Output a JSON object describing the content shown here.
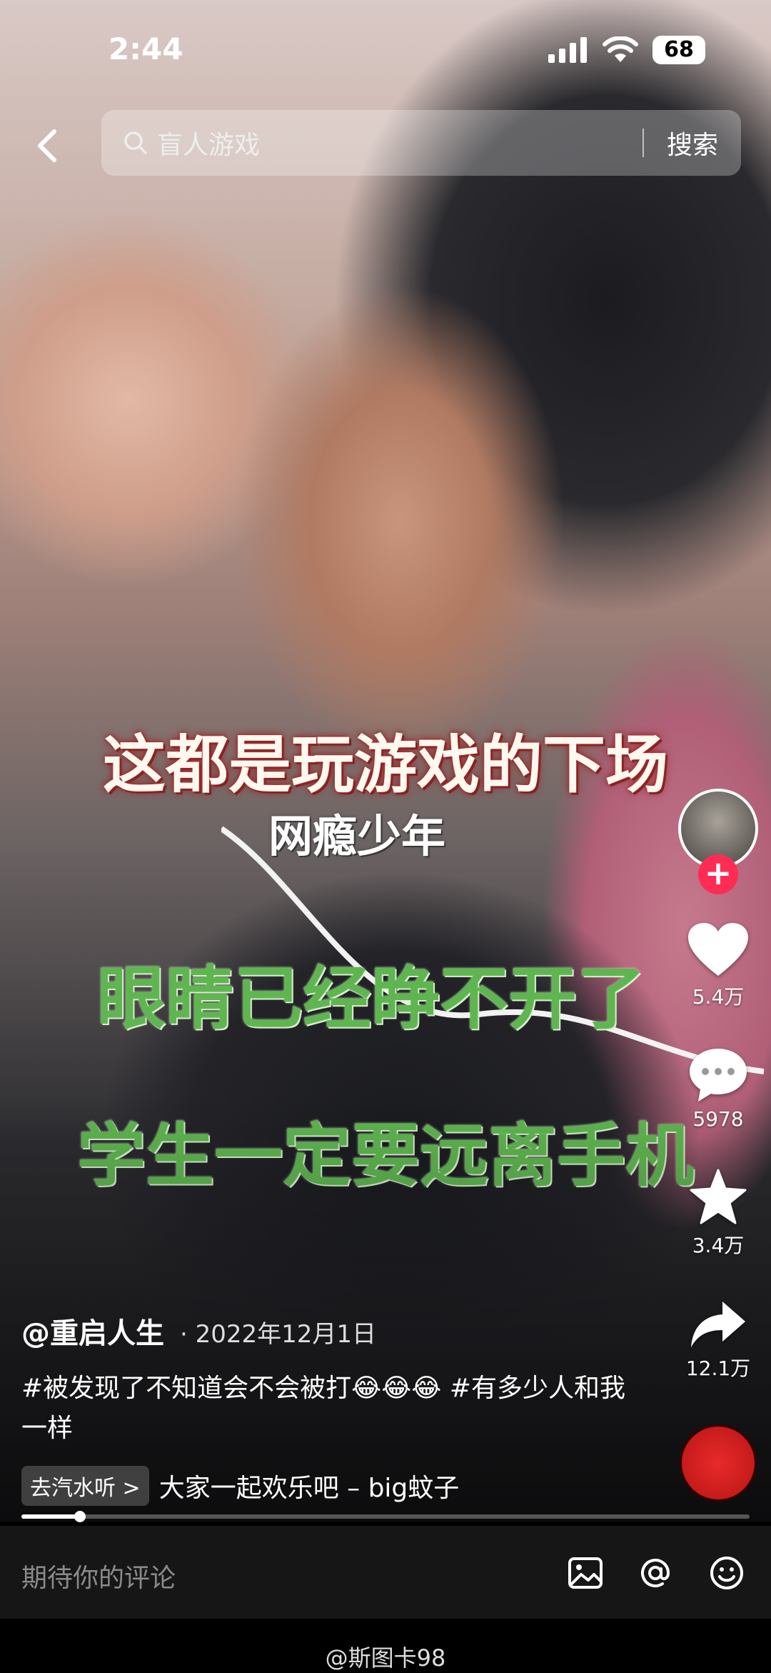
{
  "status": {
    "time": "2:44",
    "battery": "68"
  },
  "search": {
    "query": "盲人游戏",
    "button_label": "搜索"
  },
  "video_captions": {
    "line1": "这都是玩游戏的下场",
    "line2": "网瘾少年",
    "line3": "眼睛已经睁不开了",
    "line4": "学生一定要远离手机"
  },
  "actions": {
    "likes": "5.4万",
    "comments": "5978",
    "favorites": "3.4万",
    "shares": "12.1万"
  },
  "post": {
    "author": "@重启人生",
    "date": "· 2022年12月1日",
    "description": "#被发现了不知道会不会被打😂😂😂 #有多少人和我一样",
    "music_tag": "去汽水听 >",
    "music_name": "大家一起欢乐吧 – big蚊子"
  },
  "progress": 0.08,
  "comment_bar": {
    "placeholder": "期待你的评论"
  },
  "watermark": "@斯图卡98",
  "colors": {
    "accent": "#fe2c55",
    "caption_green": "#5fb650"
  }
}
